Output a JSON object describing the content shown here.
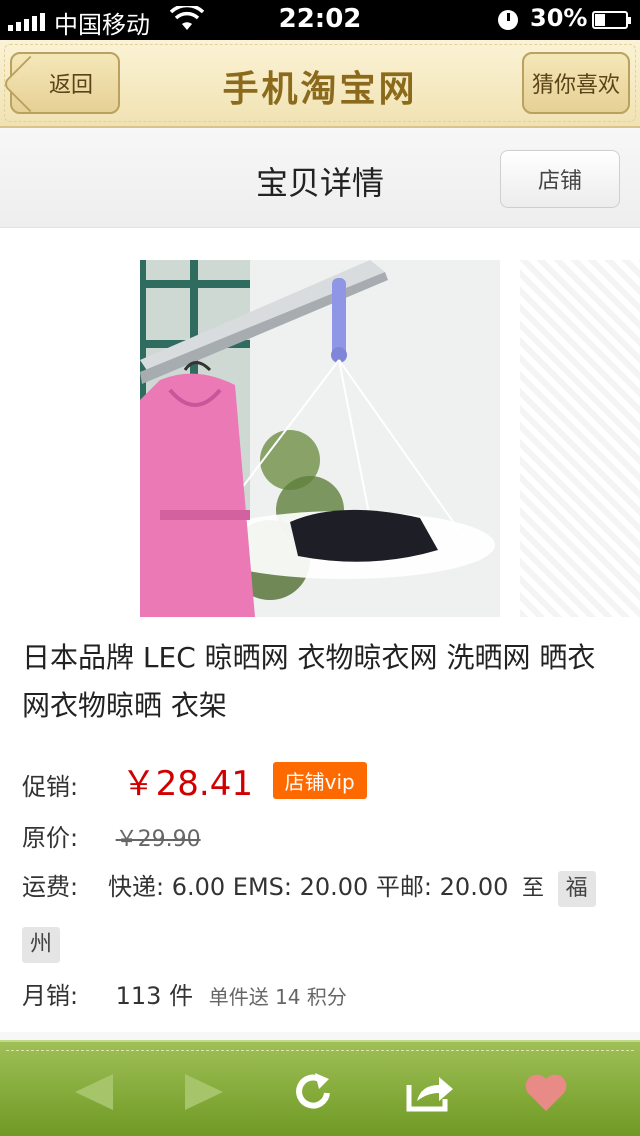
{
  "status_bar": {
    "carrier": "中国移动",
    "time": "22:02",
    "battery": "30%"
  },
  "nav": {
    "back_label": "返回",
    "title": "手机淘宝网",
    "guess_label": "猜你喜欢"
  },
  "header": {
    "title": "宝贝详情",
    "shop_label": "店铺"
  },
  "product": {
    "title": "日本品牌 LEC 晾晒网 衣物晾衣网 洗晒网 晒衣网衣物晾晒 衣架",
    "promo_label": "促销:",
    "promo_price": "￥28.41",
    "vip_badge": "店铺vip",
    "orig_label": "原价:",
    "orig_price": "￥29.90",
    "shipping_label": "运费:",
    "shipping_text": "快递: 6.00 EMS: 20.00 平邮: 20.00",
    "shipping_to": "至",
    "destination_1": "福",
    "destination_2": "州",
    "sales_label": "月销:",
    "sales_count": "113 件",
    "sales_note": "单件送 14 积分"
  },
  "toolbar": {
    "icons": [
      "back-arrow-icon",
      "forward-arrow-icon",
      "refresh-icon",
      "share-icon",
      "heart-icon"
    ]
  },
  "colors": {
    "price": "#d00000",
    "vip": "#ff6a00",
    "toolbar": "#7fa531",
    "nav_title": "#8c6a1c"
  }
}
